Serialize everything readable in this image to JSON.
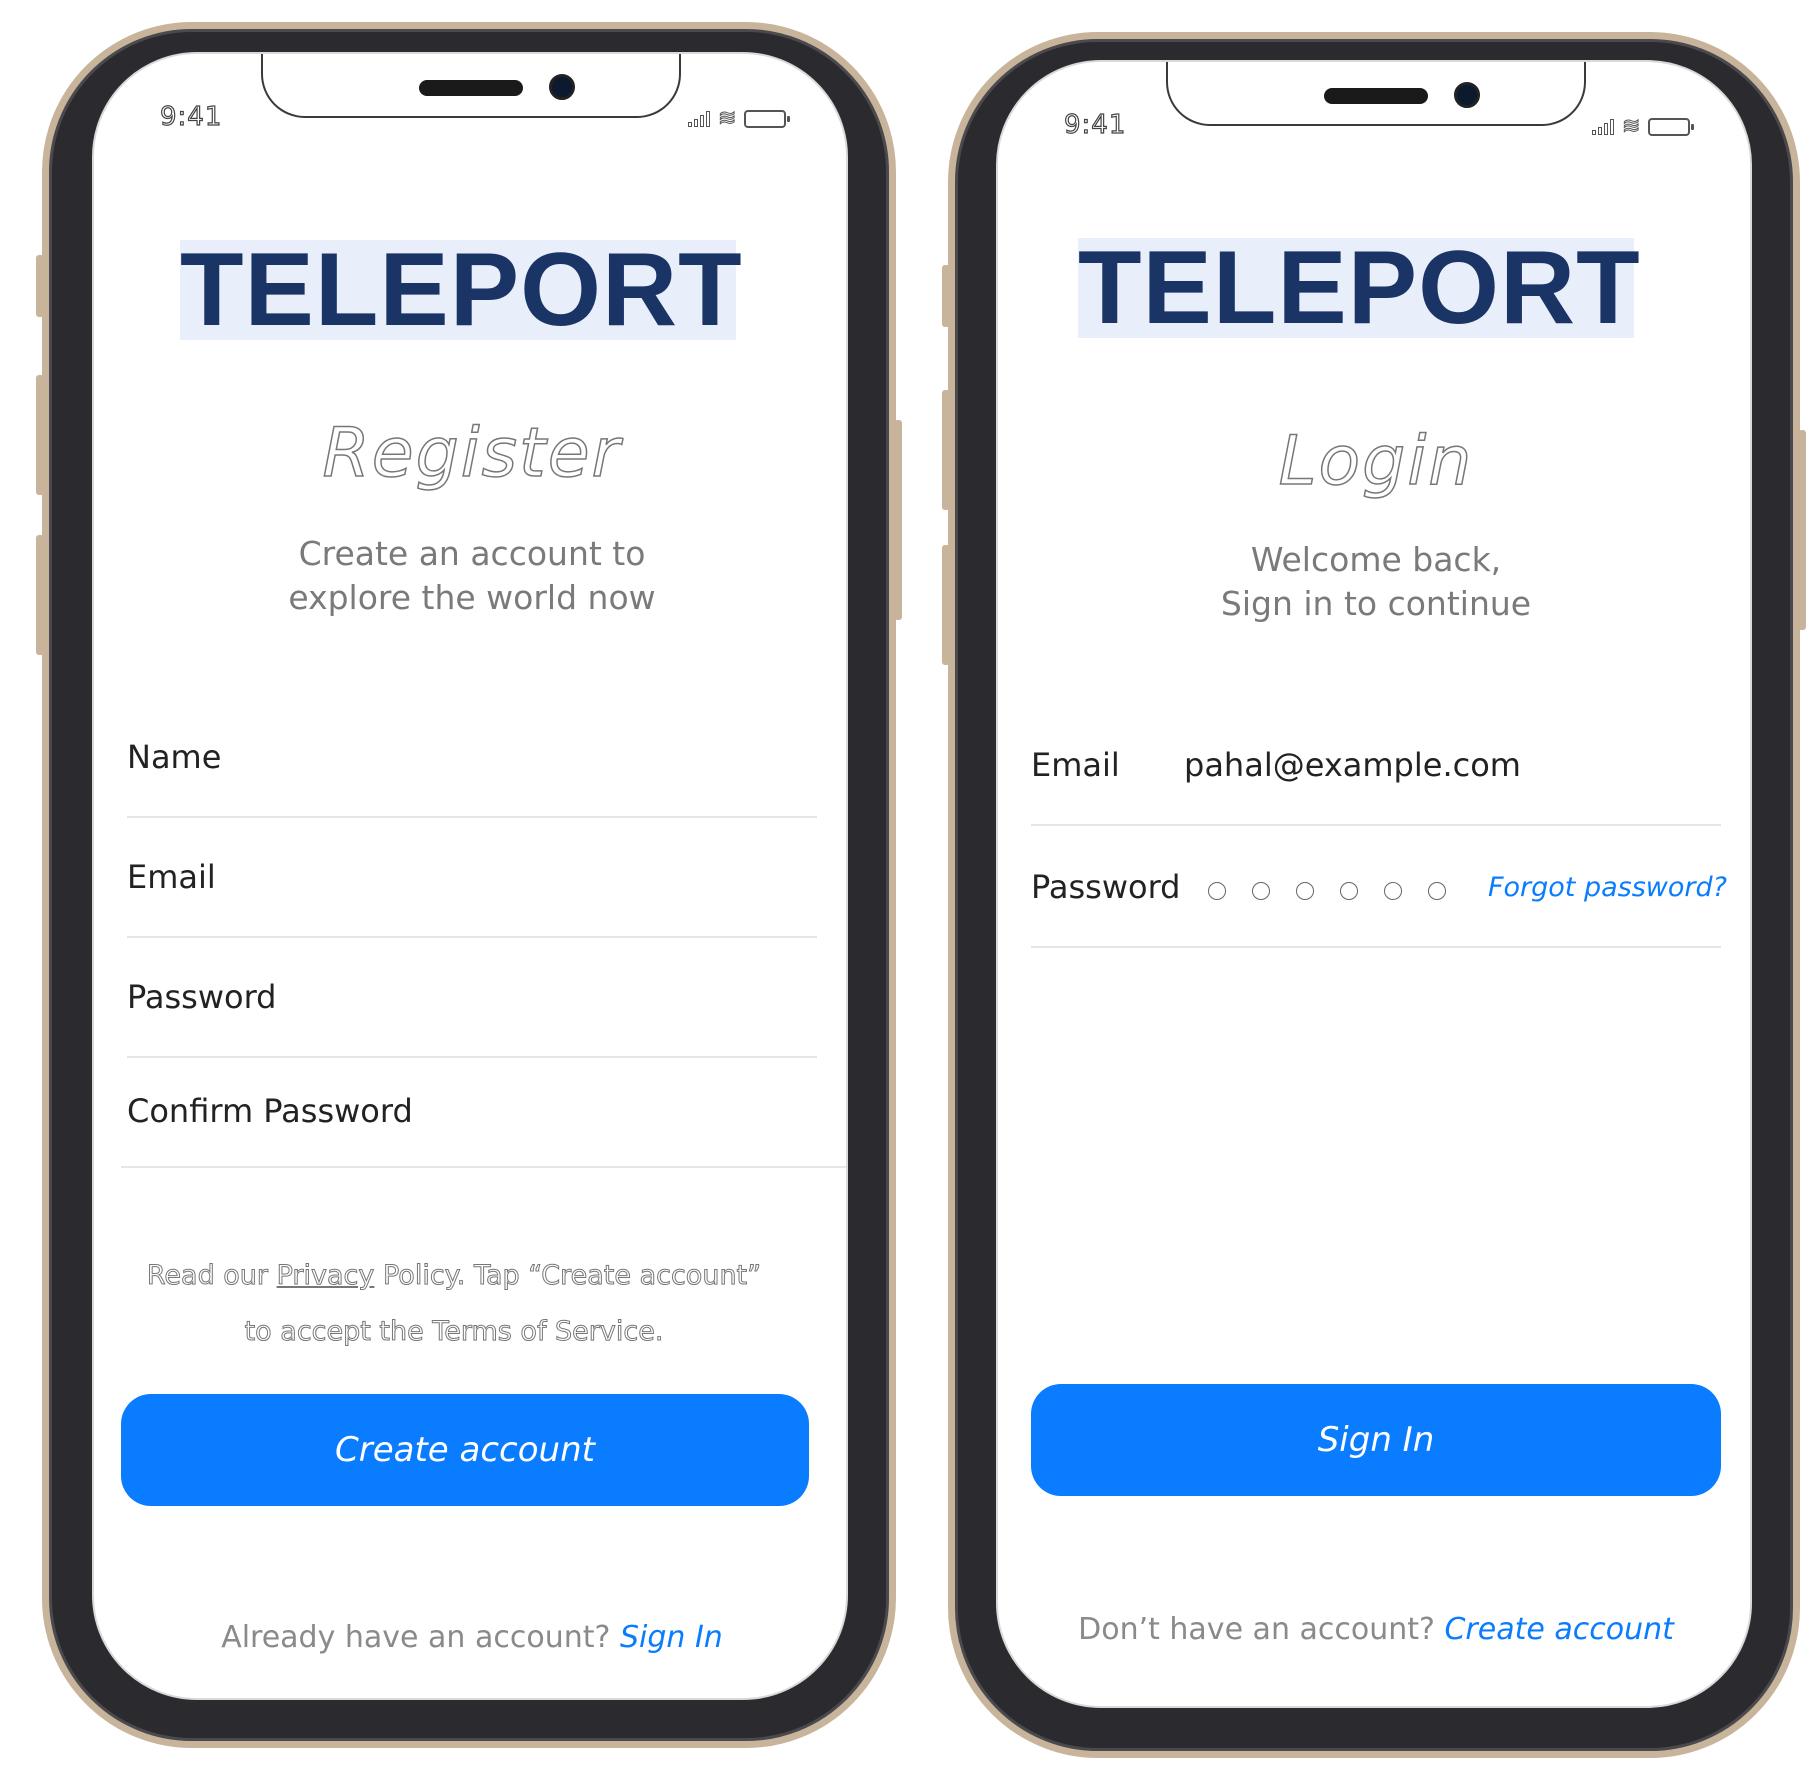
{
  "register_screen": {
    "status_time": "9:41",
    "logo": "TELEPORT",
    "title": "Register",
    "subtitle_line1": "Create an account to",
    "subtitle_line2": "explore the world now",
    "fields": [
      {
        "label": "Name"
      },
      {
        "label": "Email"
      },
      {
        "label": "Password"
      },
      {
        "label": "Confirm Password"
      }
    ],
    "legal_prefix": "Read our",
    "legal_link": "Privacy",
    "legal_rest_line1": "Policy. Tap “Create account”",
    "legal_line2": "to accept the Terms of Service.",
    "primary_button": "Create account",
    "footer_text": "Already have an account?",
    "footer_link": "Sign In"
  },
  "login_screen": {
    "status_time": "9:41",
    "logo": "TELEPORT",
    "title": "Login",
    "subtitle_line1": "Welcome back,",
    "subtitle_line2": "Sign in to continue",
    "email_label": "Email",
    "email_value": "pahal@example.com",
    "password_label": "Password",
    "forgot_link": "Forgot password?",
    "primary_button": "Sign In",
    "footer_text": "Don’t have an account?",
    "footer_link": "Create account"
  },
  "colors": {
    "accent": "#0a7cff",
    "logo_text": "#1b3466",
    "logo_bg": "#e9eefb",
    "frame_gold": "#c8b49a"
  }
}
